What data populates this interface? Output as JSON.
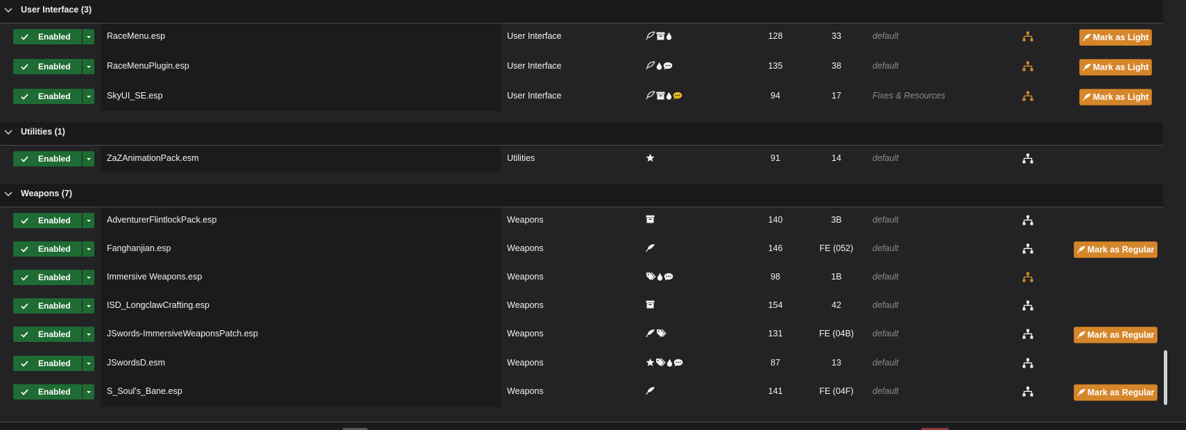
{
  "colors": {
    "enabled_green": "#1e6b33",
    "mark_orange": "#d5862a",
    "tree_orange": "#d98a2f",
    "tree_white": "#f2f2f2",
    "comment_yellow": "#e8b627",
    "profile_gray": "#8c8c90"
  },
  "groups": [
    {
      "title": "User Interface (3)",
      "top": 0,
      "rows": [
        {
          "status": "Enabled",
          "name": "RaceMenu.esp",
          "category": "User Interface",
          "flags": [
            "feather-outline-icon",
            "archive-icon",
            "drop-icon"
          ],
          "num1": "128",
          "num2": "33",
          "profile": "default",
          "tree": "orange",
          "mark": "Mark as Light"
        },
        {
          "status": "Enabled",
          "name": "RaceMenuPlugin.esp",
          "category": "User Interface",
          "flags": [
            "feather-outline-icon",
            "drop-icon",
            "comment-icon"
          ],
          "num1": "135",
          "num2": "38",
          "profile": "default",
          "tree": "orange",
          "mark": "Mark as Light"
        },
        {
          "status": "Enabled",
          "name": "SkyUI_SE.esp",
          "category": "User Interface",
          "flags": [
            "feather-outline-icon",
            "archive-icon",
            "drop-icon",
            "comment-yellow-icon"
          ],
          "num1": "94",
          "num2": "17",
          "profile": "Fixes & Resources",
          "tree": "orange",
          "mark": "Mark as Light"
        }
      ]
    },
    {
      "title": "Utilities (1)",
      "rows": [
        {
          "status": "Enabled",
          "name": "ZaZAnimationPack.esm",
          "category": "Utilities",
          "flags": [
            "star-icon"
          ],
          "num1": "91",
          "num2": "14",
          "profile": "default",
          "tree": "white",
          "mark": ""
        }
      ]
    },
    {
      "title": "Weapons (7)",
      "rows": [
        {
          "status": "Enabled",
          "name": "AdventurerFlintlockPack.esp",
          "category": "Weapons",
          "flags": [
            "archive-icon"
          ],
          "num1": "140",
          "num2": "3B",
          "profile": "default",
          "tree": "white",
          "mark": ""
        },
        {
          "status": "Enabled",
          "name": "Fanghanjian.esp",
          "category": "Weapons",
          "flags": [
            "feather-icon"
          ],
          "num1": "146",
          "num2": "FE (052)",
          "profile": "default",
          "tree": "white",
          "mark": "Mark as Regular"
        },
        {
          "status": "Enabled",
          "name": "Immersive Weapons.esp",
          "category": "Weapons",
          "flags": [
            "tags-icon",
            "drop-icon",
            "comment-icon"
          ],
          "num1": "98",
          "num2": "1B",
          "profile": "default",
          "tree": "orange",
          "mark": ""
        },
        {
          "status": "Enabled",
          "name": "ISD_LongclawCrafting.esp",
          "category": "Weapons",
          "flags": [
            "archive-icon"
          ],
          "num1": "154",
          "num2": "42",
          "profile": "default",
          "tree": "white",
          "mark": ""
        },
        {
          "status": "Enabled",
          "name": "JSwords-ImmersiveWeaponsPatch.esp",
          "category": "Weapons",
          "flags": [
            "feather-icon",
            "tags-icon"
          ],
          "num1": "131",
          "num2": "FE (04B)",
          "profile": "default",
          "tree": "white",
          "mark": "Mark as Regular"
        },
        {
          "status": "Enabled",
          "name": "JSwordsD.esm",
          "category": "Weapons",
          "flags": [
            "star-icon",
            "tags-icon",
            "drop-icon",
            "comment-icon"
          ],
          "num1": "87",
          "num2": "13",
          "profile": "default",
          "tree": "white",
          "mark": ""
        },
        {
          "status": "Enabled",
          "name": "S_Soul's_Bane.esp",
          "category": "Weapons",
          "flags": [
            "feather-icon"
          ],
          "num1": "141",
          "num2": "FE (04F)",
          "profile": "default",
          "tree": "white",
          "mark": "Mark as Regular"
        }
      ]
    }
  ]
}
